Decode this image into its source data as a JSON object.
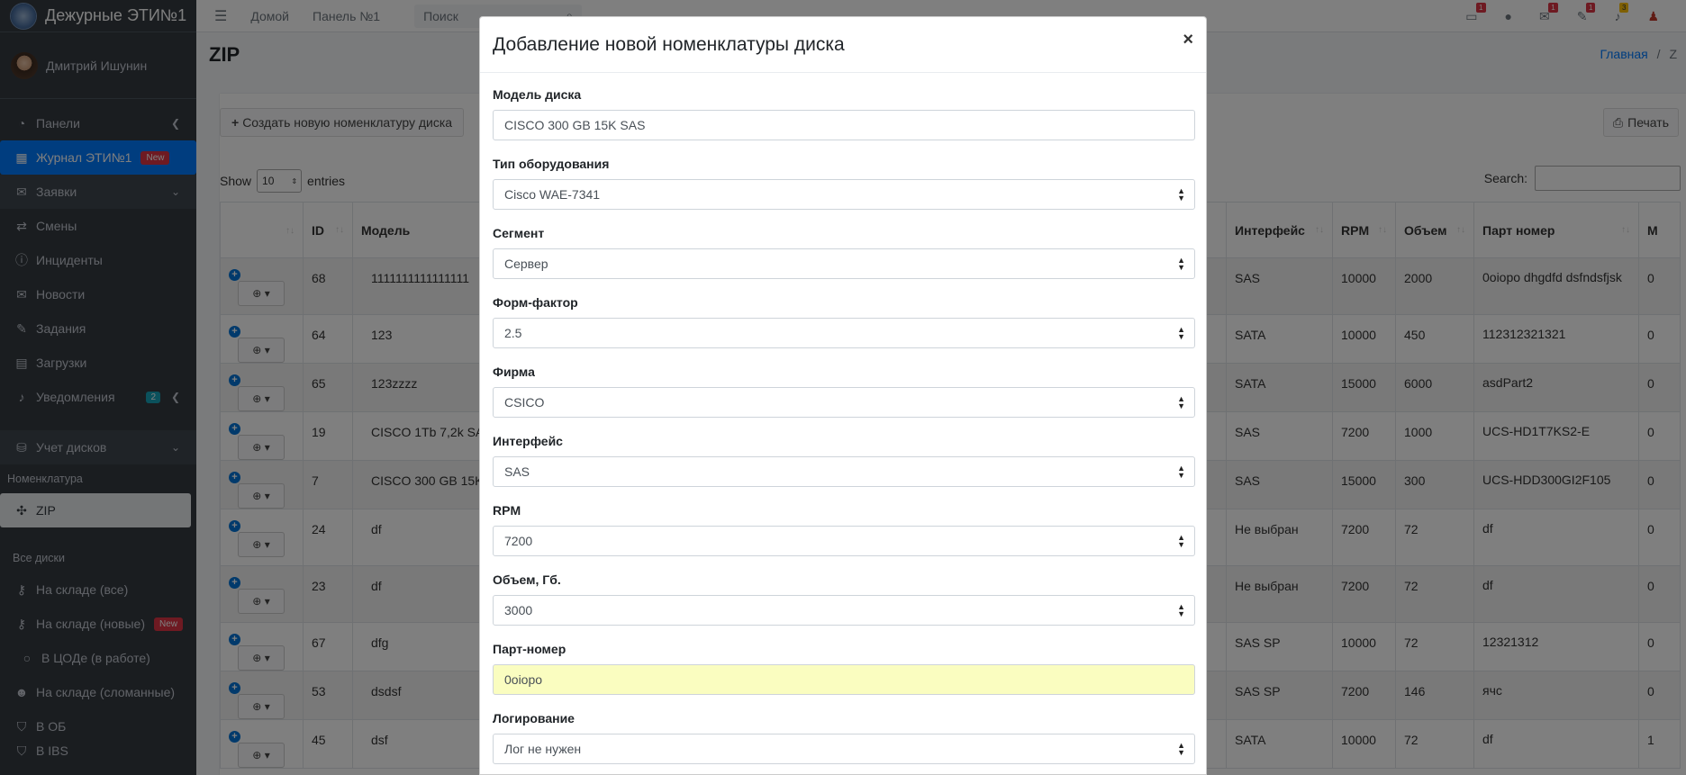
{
  "brand": "Дежурные ЭТИ№1",
  "user": "Дмитрий Ишунин",
  "sidebar": {
    "panels": "Панели",
    "journal": "Журнал ЭТИ№1",
    "journal_badge": "New",
    "requests": "Заявки",
    "shifts": "Смены",
    "incidents": "Инциденты",
    "news": "Новости",
    "tasks": "Задания",
    "downloads": "Загрузки",
    "notifications": "Уведомления",
    "notifications_count": "2",
    "disks": "Учет дисков",
    "nomenclature_header": "Номенклатура",
    "zip": "ZIP",
    "all_disks_header": "Все диски",
    "stock_all": "На складе (все)",
    "stock_new": "На складе (новые)",
    "stock_new_badge": "New",
    "in_dc": "В ЦОДе (в работе)",
    "stock_broken": "На складе (сломанные)",
    "in_ob": "В ОБ",
    "cut_item": "В IBS"
  },
  "topbar": {
    "home": "Домой",
    "panel": "Панель №1",
    "search_placeholder": "Поиск",
    "badges": [
      "1",
      "1",
      "1",
      "3"
    ]
  },
  "page": {
    "title": "ZIP",
    "breadcrumb_home": "Главная",
    "breadcrumb_sep": "/",
    "breadcrumb_current": "Z",
    "create_button": "Создать новую номенклатуру диска",
    "print_button": "Печать",
    "show_label": "Show",
    "show_value": "10",
    "entries_label": "entries",
    "search_label": "Search:"
  },
  "table": {
    "headers": [
      "",
      "ID",
      "Модель",
      "Интерфейс",
      "RPM",
      "Объем",
      "Парт номер",
      "М"
    ],
    "rows": [
      {
        "id": "68",
        "model": "1111111111111111",
        "iface": "SAS",
        "rpm": "10000",
        "vol": "2000",
        "part": "0oiopo dhgdfd dsfndsfjsk",
        "m": "0"
      },
      {
        "id": "64",
        "model": "123",
        "iface": "SATA",
        "rpm": "10000",
        "vol": "450",
        "part": "112312321321",
        "m": "0"
      },
      {
        "id": "65",
        "model": "123zzzz",
        "iface": "SATA",
        "rpm": "15000",
        "vol": "6000",
        "part": "asdPart2",
        "m": "0"
      },
      {
        "id": "19",
        "model": "CISCO 1Tb 7,2k SA",
        "iface": "SAS",
        "rpm": "7200",
        "vol": "1000",
        "part": "UCS-HD1T7KS2-E",
        "m": "0"
      },
      {
        "id": "7",
        "model": "CISCO 300 GB 15K",
        "iface": "SAS",
        "rpm": "15000",
        "vol": "300",
        "part": "UCS-HDD300GI2F105",
        "m": "0"
      },
      {
        "id": "24",
        "model": "df",
        "iface": "Не выбран",
        "rpm": "7200",
        "vol": "72",
        "part": "df",
        "m": "0"
      },
      {
        "id": "23",
        "model": "df",
        "iface": "Не выбран",
        "rpm": "7200",
        "vol": "72",
        "part": "df",
        "m": "0"
      },
      {
        "id": "67",
        "model": "dfg",
        "iface": "SAS SP",
        "rpm": "10000",
        "vol": "72",
        "part": "12321312",
        "m": "0"
      },
      {
        "id": "53",
        "model": "dsdsf",
        "iface": "SAS SP",
        "rpm": "7200",
        "vol": "146",
        "part": "ячс",
        "m": "0"
      },
      {
        "id": "45",
        "model": "dsf",
        "iface": "SATA",
        "rpm": "10000",
        "vol": "72",
        "part": "df",
        "m": "1"
      }
    ]
  },
  "modal": {
    "title": "Добавление новой номенклатуры диска",
    "close": "×",
    "fields": [
      {
        "label": "Модель диска",
        "value": "CISCO 300 GB 15K SAS"
      },
      {
        "label": "Тип оборудования",
        "value": "Cisco WAE-7341"
      },
      {
        "label": "Сегмент",
        "value": "Сервер"
      },
      {
        "label": "Форм-фактор",
        "value": "2.5"
      },
      {
        "label": "Фирма",
        "value": "CSICO"
      },
      {
        "label": "Интерфейс",
        "value": "SAS"
      },
      {
        "label": "RPM",
        "value": "7200"
      },
      {
        "label": "Объем, Гб.",
        "value": "3000"
      },
      {
        "label": "Парт-номер",
        "value": "0oiopo"
      },
      {
        "label": "Логирование",
        "value": "Лог не нужен"
      }
    ]
  }
}
